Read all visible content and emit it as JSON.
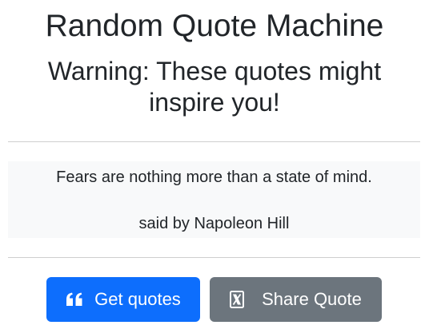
{
  "header": {
    "title": "Random Quote Machine",
    "subtitle": "Warning: These quotes might inspire you!"
  },
  "quote": {
    "text": "Fears are nothing more than a state of mind.",
    "author": "said by Napoleon Hill"
  },
  "actions": {
    "get_quotes": {
      "label": "Get quotes",
      "icon": "quote-left-icon",
      "color": "#0d6efd"
    },
    "share_quote": {
      "label": "Share Quote",
      "icon": "x-twitter-icon",
      "color": "#6c757d"
    }
  }
}
